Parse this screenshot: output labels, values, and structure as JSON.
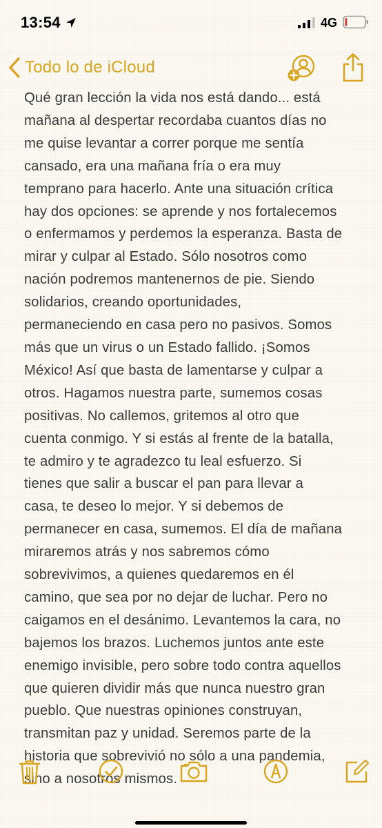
{
  "status_bar": {
    "time": "13:54",
    "network": "4G",
    "signal_bars": 3,
    "battery_level": 0.1,
    "icons": [
      "location-arrow-icon",
      "signal-icon",
      "battery-icon"
    ]
  },
  "nav": {
    "back_label": "Todo lo de iCloud",
    "collaborate_icon": "add-person-icon",
    "share_icon": "share-icon"
  },
  "note": {
    "lines": [
      "Qué gran lección la vida nos está dando... está",
      "mañana al despertar recordaba cuantos días no",
      "me quise levantar a correr porque me sentía",
      "cansado, era una mañana fría o era muy",
      "temprano para hacerlo. Ante una situación crítica",
      "hay dos opciones: se aprende y nos fortalecemos",
      "o enfermamos y perdemos la esperanza. Basta de",
      "mirar y culpar al Estado. Sólo nosotros como",
      "nación podremos mantenernos de pie. Siendo",
      "solidarios, creando oportunidades,",
      "permaneciendo en casa pero no pasivos. Somos",
      "más que un virus o un Estado fallido. ¡Somos",
      "México! Así que basta de lamentarse y culpar a",
      "otros. Hagamos nuestra parte, sumemos cosas",
      "positivas. No callemos, gritemos al otro que",
      "cuenta conmigo. Y si estás al frente de la batalla,",
      "te admiro y te agradezco tu leal esfuerzo. Si",
      "tienes que salir a buscar el pan para llevar a",
      "casa, te deseo lo mejor. Y si debemos de",
      "permanecer en casa, sumemos. El día de mañana",
      "miraremos atrás y nos sabremos cómo",
      "sobrevivimos, a quienes quedaremos en él",
      "camino, que sea por no dejar de luchar. Pero no",
      "caigamos en el desánimo. Levantemos la cara, no",
      "bajemos los brazos. Luchemos juntos ante este",
      "enemigo invisible, pero sobre todo contra aquellos",
      "que quieren dividir más que nunca nuestro gran",
      "pueblo. Que nuestras opiniones construyan,",
      "transmitan paz y unidad. Seremos parte de la",
      "historia que sobrevivió no sólo a una pandemia,",
      "sino a nosotros mismos."
    ]
  },
  "toolbar": {
    "items": [
      "trash-icon",
      "checklist-icon",
      "camera-icon",
      "markup-icon",
      "compose-icon"
    ]
  },
  "colors": {
    "accent": "#d9a520",
    "paper": "#fbf9f1",
    "text": "#3a3a3a",
    "battery_low": "#e0302a"
  }
}
